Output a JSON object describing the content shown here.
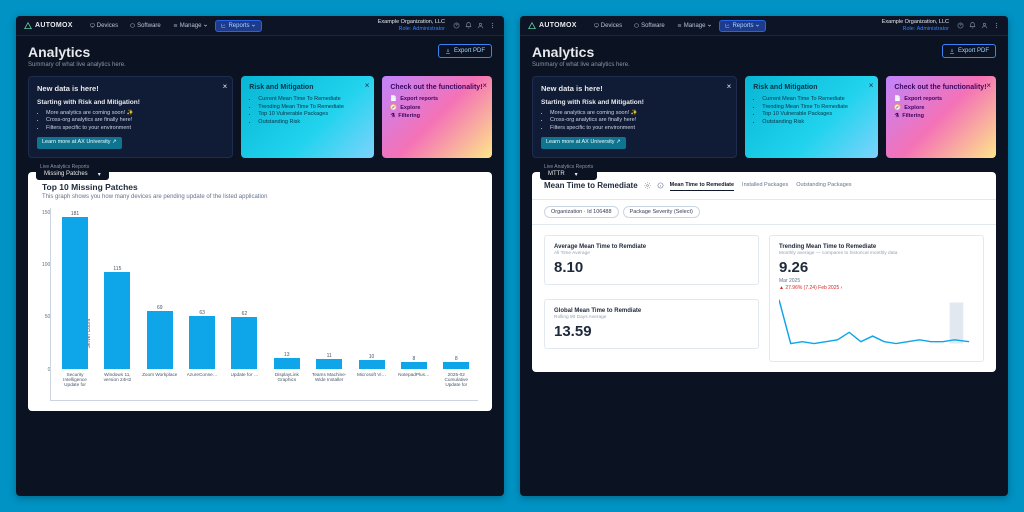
{
  "brand": "AUTOMOX",
  "nav": {
    "devices": "Devices",
    "software": "Software",
    "manage": "Manage",
    "reports": "Reports"
  },
  "org": {
    "name": "Example Organization, LLC",
    "role": "Role: Administrator"
  },
  "page": {
    "title": "Analytics",
    "subtitle": "Summary of what live analytics here.",
    "export": "Export PDF"
  },
  "promo": {
    "card1": {
      "title": "New data is here!",
      "subtitle": "Starting with Risk and Mitigation!",
      "items": [
        "More analytics are coming soon! ✨",
        "Cross-org analytics are finally here!",
        "Filters specific to your environment"
      ],
      "cta": "Learn more at AX University ↗"
    },
    "card2": {
      "title": "Risk and Mitigation",
      "items": [
        "Current Mean Time To Remediate",
        "Trending Mean Time To Remediate",
        "Top 10 Vulnerable Packages",
        "Outstanding Risk"
      ]
    },
    "card3": {
      "title": "Check out the functionality!",
      "items": [
        "Export reports",
        "Explore",
        "Filtering"
      ]
    }
  },
  "selector_label": "Live Analytics Reports",
  "left": {
    "selector": "Missing Patches",
    "chart": {
      "title": "Top 10 Missing Patches",
      "subtitle": "This graph shows you how many devices are pending update of the listed application",
      "yaxis": "Server Count",
      "ticks": [
        "150",
        "100",
        "50",
        "0"
      ]
    }
  },
  "right": {
    "selector": "MTTR",
    "panel_title": "Mean Time to Remediate",
    "tabs": {
      "t1": "Mean Time to Remediate",
      "t2": "Installed Packages",
      "t3": "Outstanding Packages"
    },
    "filters": {
      "f1": "Organization · Id 106488",
      "f2": "Package Severity (Select)"
    },
    "metrics": {
      "avg": {
        "t": "Average Mean Time to Remdiate",
        "s": "All Time Average",
        "v": "8.10"
      },
      "global": {
        "t": "Global Mean Time to Remdiate",
        "s": "Rolling 90 Days Average",
        "v": "13.59"
      },
      "trend": {
        "t": "Trending Mean Time to Remediate",
        "s": "Monthly average — compares to historical monthly data",
        "v": "9.26",
        "month": "Mar 2025",
        "delta": "▲ 27.96% (7.24) Feb 2025 ›"
      }
    }
  },
  "chart_data": {
    "type": "bar",
    "title": "Top 10 Missing Patches",
    "ylabel": "Server Count",
    "xlabel": "",
    "ylim": [
      0,
      190
    ],
    "categories": [
      "Security Intelligence Update for",
      "Windows 11, version 24H2",
      "Zoom Workplace",
      "AzureConne…",
      "Update for …",
      "DisplayLink Graphics",
      "Teams Machine-Wide Installer",
      "Microsoft Vi…",
      "NotepadPlus…",
      "2025-02 Cumulative Update for"
    ],
    "values": [
      181,
      115,
      69,
      63,
      62,
      13,
      11,
      10,
      8,
      8
    ]
  }
}
